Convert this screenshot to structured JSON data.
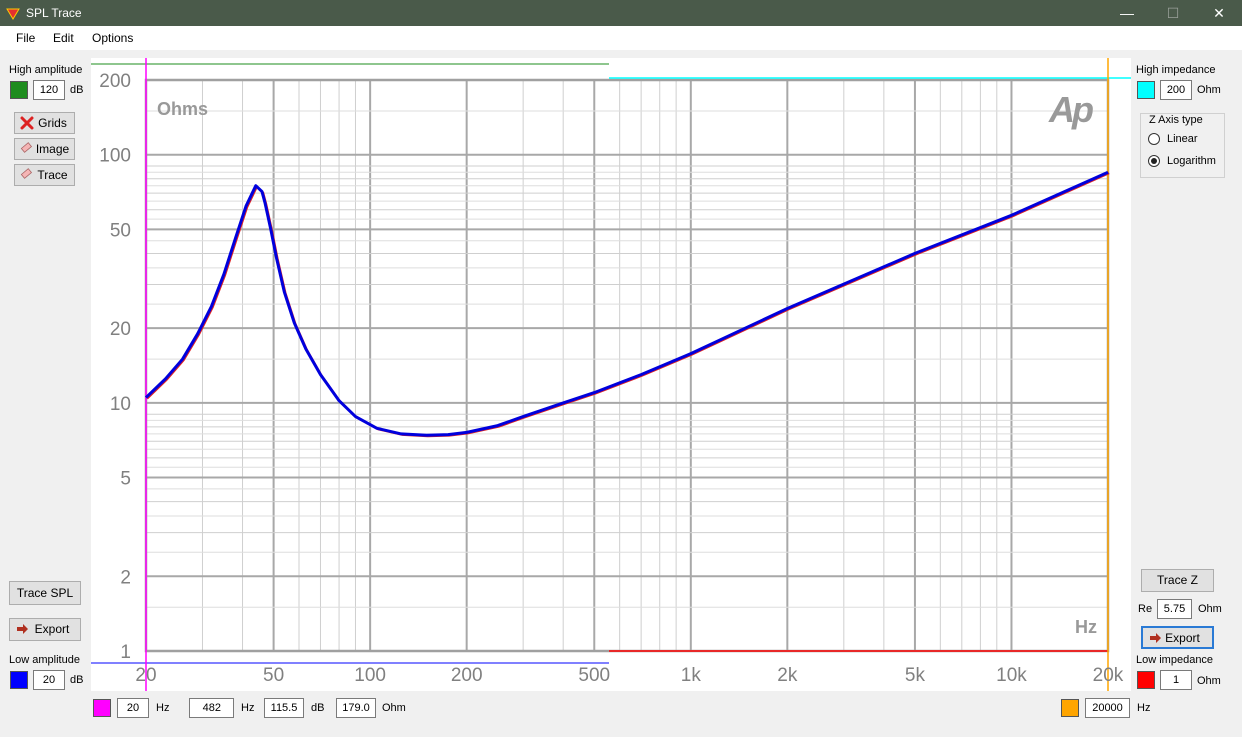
{
  "window": {
    "title": "SPL Trace",
    "minimize": "—",
    "maximize": "☐",
    "close": "✕"
  },
  "menu": {
    "file": "File",
    "edit": "Edit",
    "options": "Options"
  },
  "left": {
    "high_amplitude_label": "High amplitude",
    "high_amplitude_value": "120",
    "high_amplitude_unit": "dB",
    "high_color": "#1e8c1e",
    "grids_label": "Grids",
    "image_label": "Image",
    "trace_label": "Trace",
    "trace_spl_label": "Trace SPL",
    "export_label": "Export",
    "low_amplitude_label": "Low amplitude",
    "low_amplitude_value": "20",
    "low_amplitude_unit": "dB",
    "low_color": "#0000ff"
  },
  "right": {
    "high_impedance_label": "High impedance",
    "high_impedance_value": "200",
    "high_impedance_unit": "Ohm",
    "high_color": "#00ffff",
    "z_axis_type_label": "Z Axis type",
    "linear_label": "Linear",
    "logarithm_label": "Logarithm",
    "z_axis_selected": "Logarithm",
    "trace_z_label": "Trace Z",
    "re_label": "Re",
    "re_value": "5.75",
    "re_unit": "Ohm",
    "export_label": "Export",
    "low_impedance_label": "Low impedance",
    "low_impedance_value": "1",
    "low_impedance_unit": "Ohm",
    "low_color": "#ff0000"
  },
  "bottom": {
    "low_freq_color": "#ff00ff",
    "low_freq_value": "20",
    "low_freq_unit": "Hz",
    "cursor_freq_value": "482",
    "cursor_freq_unit": "Hz",
    "cursor_db_value": "115.5",
    "cursor_db_unit": "dB",
    "cursor_ohm_value": "179.0",
    "cursor_ohm_unit": "Ohm",
    "high_freq_color": "#ffa500",
    "high_freq_value": "20000",
    "high_freq_unit": "Hz"
  },
  "chart_data": {
    "type": "line",
    "y_unit_label": "Ohms",
    "x_unit_label": "Hz",
    "logo": "Ap",
    "x_scale": "log",
    "y_scale": "log",
    "xlim": [
      20,
      20000
    ],
    "ylim": [
      1,
      200
    ],
    "grid": true,
    "x_tick_labels": [
      {
        "v": 20,
        "t": "20"
      },
      {
        "v": 50,
        "t": "50"
      },
      {
        "v": 100,
        "t": "100"
      },
      {
        "v": 200,
        "t": "200"
      },
      {
        "v": 500,
        "t": "500"
      },
      {
        "v": 1000,
        "t": "1k"
      },
      {
        "v": 2000,
        "t": "2k"
      },
      {
        "v": 5000,
        "t": "5k"
      },
      {
        "v": 10000,
        "t": "10k"
      },
      {
        "v": 20000,
        "t": "20k"
      }
    ],
    "y_tick_labels": [
      {
        "v": 200,
        "t": "200"
      },
      {
        "v": 100,
        "t": "100"
      },
      {
        "v": 50,
        "t": "50"
      },
      {
        "v": 20,
        "t": "20"
      },
      {
        "v": 10,
        "t": "10"
      },
      {
        "v": 5,
        "t": "5"
      },
      {
        "v": 2,
        "t": "2"
      },
      {
        "v": 1,
        "t": "1"
      }
    ],
    "series": [
      {
        "color": "#0000dd",
        "shadow_color": "#dd2222",
        "x": [
          20,
          23,
          26,
          29,
          32,
          35,
          38,
          41,
          44,
          46,
          47,
          49,
          51,
          54,
          58,
          63,
          70,
          80,
          90,
          105,
          125,
          150,
          175,
          200,
          250,
          300,
          400,
          500,
          700,
          1000,
          2000,
          5000,
          10000,
          20000
        ],
        "y": [
          10.5,
          12.5,
          15.0,
          19.0,
          24.5,
          33.0,
          46.0,
          62.0,
          75.0,
          71.0,
          64.0,
          50.0,
          38.5,
          28.0,
          21.0,
          16.5,
          13.0,
          10.2,
          8.8,
          7.9,
          7.5,
          7.4,
          7.45,
          7.6,
          8.1,
          8.8,
          10.0,
          11.0,
          13.0,
          15.8,
          24.0,
          40.0,
          57.0,
          85.0
        ]
      }
    ]
  }
}
